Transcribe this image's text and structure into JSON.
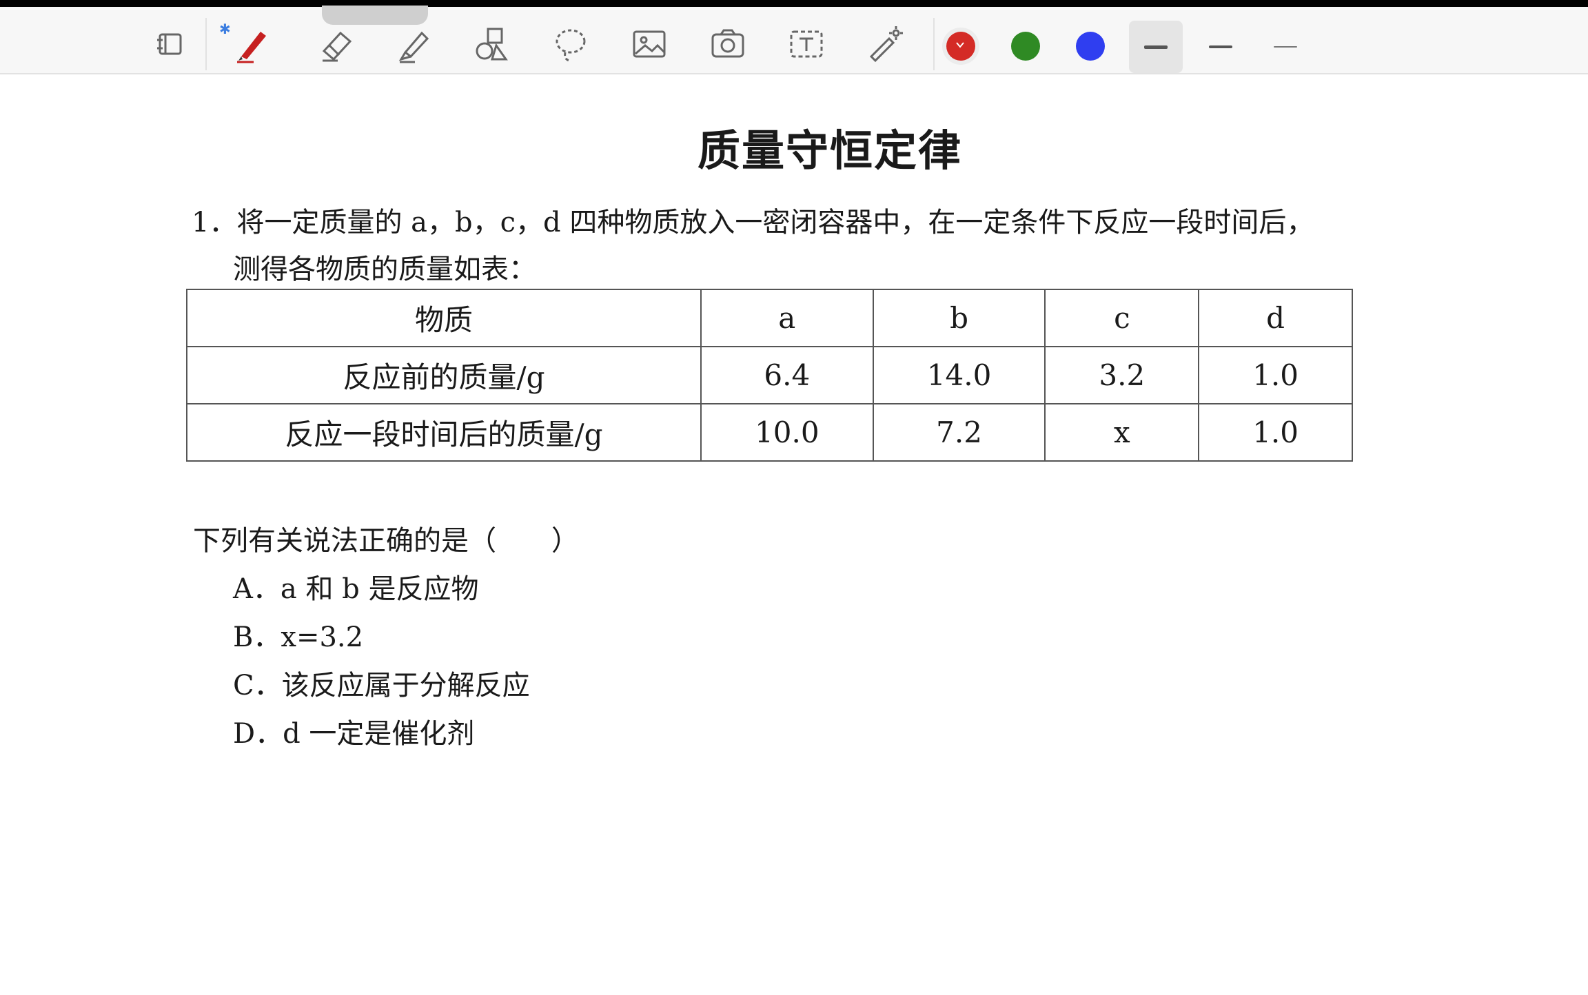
{
  "toolbar": {
    "tools": [
      {
        "name": "page-tool",
        "icon": "page-icon"
      },
      {
        "name": "pen-tool",
        "icon": "pen-icon"
      },
      {
        "name": "eraser-tool",
        "icon": "eraser-icon"
      },
      {
        "name": "highlighter-tool",
        "icon": "highlighter-icon"
      },
      {
        "name": "shapes-tool",
        "icon": "shapes-icon"
      },
      {
        "name": "lasso-tool",
        "icon": "lasso-icon"
      },
      {
        "name": "image-tool",
        "icon": "image-icon"
      },
      {
        "name": "camera-tool",
        "icon": "camera-icon"
      },
      {
        "name": "text-tool",
        "icon": "text-icon"
      },
      {
        "name": "laser-pointer-tool",
        "icon": "laser-pointer-icon"
      }
    ],
    "bluetooth_glyph": "✱",
    "colors": [
      {
        "name": "red",
        "hex": "#d42b26",
        "selected": true
      },
      {
        "name": "green",
        "hex": "#2f8a24",
        "selected": false
      },
      {
        "name": "blue",
        "hex": "#2f3ef0",
        "selected": false
      }
    ],
    "stroke_widths": [
      "thick",
      "medium",
      "thin"
    ],
    "selected_stroke": "thick"
  },
  "document": {
    "title": "质量守恒定律",
    "question_line1": "1．将一定质量的 a，b，c，d 四种物质放入一密闭容器中，在一定条件下反应一段时间后，",
    "question_line2": "测得各物质的质量如表：",
    "table": {
      "header": [
        "物质",
        "a",
        "b",
        "c",
        "d"
      ],
      "rows": [
        [
          "反应前的质量/g",
          "6.4",
          "14.0",
          "3.2",
          "1.0"
        ],
        [
          "反应一段时间后的质量/g",
          "10.0",
          "7.2",
          "x",
          "1.0"
        ]
      ]
    },
    "prompt": "下列有关说法正确的是（　　）",
    "options": [
      "A．a 和 b 是反应物",
      "B．x=3.2",
      "C．该反应属于分解反应",
      "D．d 一定是催化剂"
    ]
  }
}
